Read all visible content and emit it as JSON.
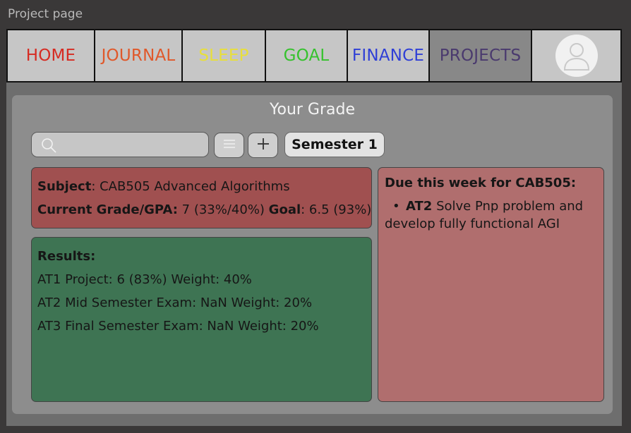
{
  "window": {
    "title": "Project page"
  },
  "nav": {
    "tabs": [
      {
        "label": "HOME",
        "color": "#d62b22"
      },
      {
        "label": "JOURNAL",
        "color": "#e0582a"
      },
      {
        "label": "SLEEP",
        "color": "#e8df3a"
      },
      {
        "label": "GOAL",
        "color": "#36c22e"
      },
      {
        "label": "FINANCE",
        "color": "#2f3fd6"
      },
      {
        "label": "PROJECTS",
        "color": "#4a3a6e"
      }
    ],
    "active_tab": "PROJECTS",
    "profile_icon": "user-avatar-icon"
  },
  "panel": {
    "title": "Your Grade",
    "search": {
      "value": "",
      "placeholder": "",
      "icon": "search-icon"
    },
    "menu_icon": "hamburger-icon",
    "add_icon": "plus-icon",
    "semester_label": "Semester 1"
  },
  "subject_card": {
    "subject_label": "Subject",
    "subject_value": ": CAB505 Advanced Algorithms",
    "grade_label": "Current Grade/GPA:",
    "grade_value": " 7 (33%/40%) ",
    "goal_label": "Goal",
    "goal_value": ": 6.5 (93%)",
    "color": "#a05050"
  },
  "results_card": {
    "heading": "Results:",
    "items": [
      "AT1 Project: 6 (83%) Weight: 40%",
      "AT2 Mid Semester Exam: NaN Weight: 20%",
      "AT3 Final Semester Exam: NaN Weight: 20%"
    ],
    "color": "#3e7453"
  },
  "due_card": {
    "heading": "Due this week for CAB505:",
    "items": [
      {
        "tag": "AT2",
        "text": " Solve Pnp problem and develop fully functional AGI"
      }
    ],
    "color": "#b06e6e"
  }
}
